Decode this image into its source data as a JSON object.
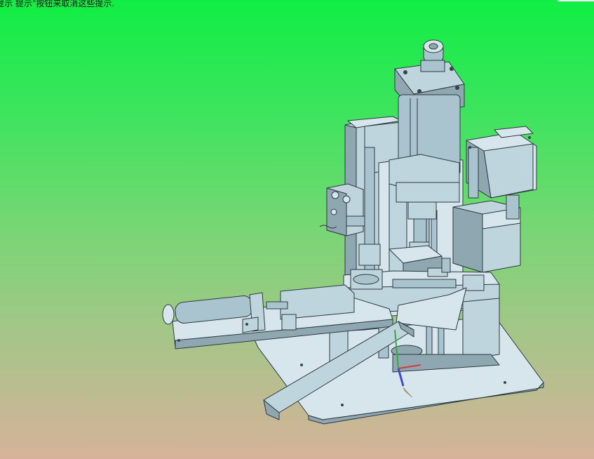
{
  "window": {
    "hint_text": "提示 提示\"按钮来取消这些提示."
  },
  "viewport": {
    "background_top": "#10ee44",
    "background_bottom": "#d6b29a"
  },
  "model": {
    "icon": "cad-assembly-model"
  },
  "triad": {
    "icon": "axis-triad-icon",
    "colors": {
      "x": "#d23a3a",
      "y": "#3aaa3a",
      "z": "#3a4ad2"
    }
  }
}
